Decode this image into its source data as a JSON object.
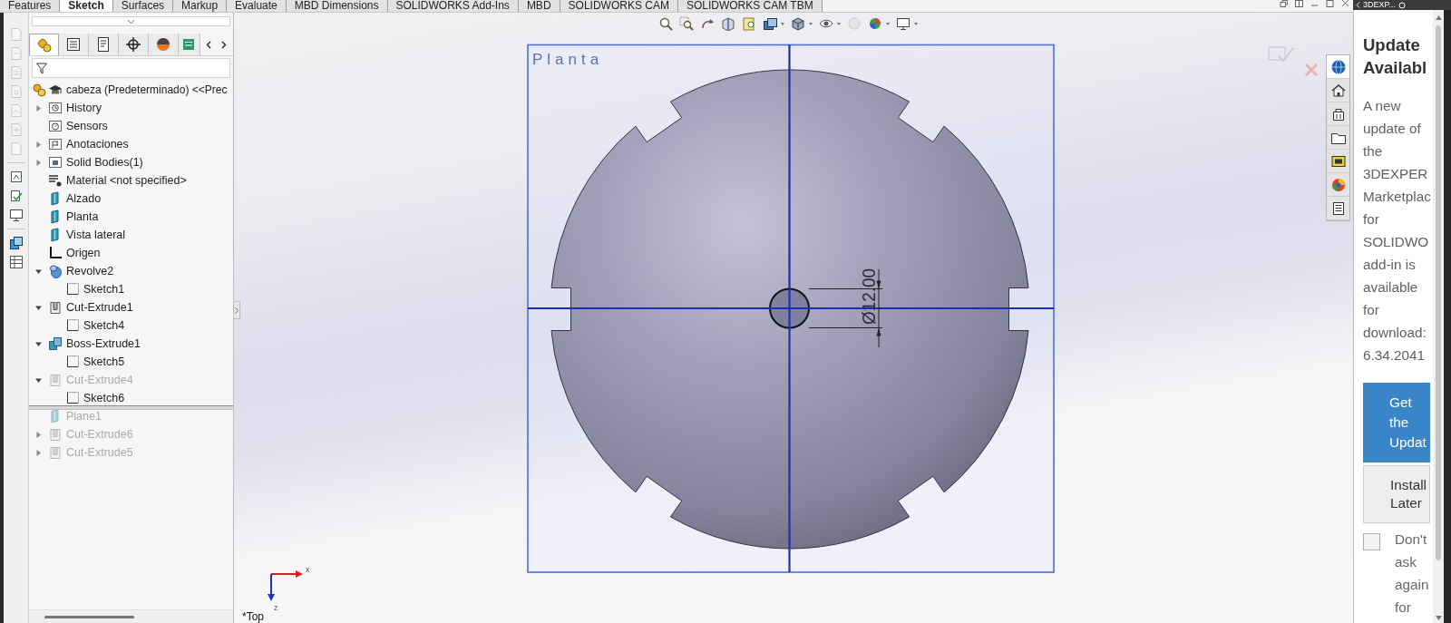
{
  "command_tabs": [
    {
      "label": "Features",
      "selected": false
    },
    {
      "label": "Sketch",
      "selected": true
    },
    {
      "label": "Surfaces",
      "selected": false
    },
    {
      "label": "Markup",
      "selected": false
    },
    {
      "label": "Evaluate",
      "selected": false
    },
    {
      "label": "MBD Dimensions",
      "selected": false
    },
    {
      "label": "SOLIDWORKS Add-Ins",
      "selected": false
    },
    {
      "label": "MBD",
      "selected": false
    },
    {
      "label": "SOLIDWORKS CAM",
      "selected": false
    },
    {
      "label": "SOLIDWORKS CAM TBM",
      "selected": false
    }
  ],
  "feature_manager": {
    "tabs": [
      {
        "kind": "features",
        "selected": true
      },
      {
        "kind": "properties",
        "selected": false
      },
      {
        "kind": "configurations",
        "selected": false
      },
      {
        "kind": "dimxpert",
        "selected": false
      },
      {
        "kind": "display",
        "selected": false
      },
      {
        "kind": "extra",
        "selected": false
      }
    ],
    "tree": {
      "label": "cabeza (Predeterminado) <<Prec",
      "kind": "part",
      "children": [
        {
          "label": "History",
          "kind": "history",
          "expanded": false,
          "suppressed": false
        },
        {
          "label": "Sensors",
          "kind": "sensors",
          "suppressed": false
        },
        {
          "label": "Anotaciones",
          "kind": "annotations",
          "expanded": false,
          "suppressed": false
        },
        {
          "label": "Solid Bodies(1)",
          "kind": "bodies",
          "expanded": false,
          "suppressed": false
        },
        {
          "label": "Material <not specified>",
          "kind": "material",
          "suppressed": false
        },
        {
          "label": "Alzado",
          "kind": "plane",
          "suppressed": false
        },
        {
          "label": "Planta",
          "kind": "plane",
          "suppressed": false
        },
        {
          "label": "Vista lateral",
          "kind": "plane",
          "suppressed": false
        },
        {
          "label": "Origen",
          "kind": "origin",
          "suppressed": false
        },
        {
          "label": "Revolve2",
          "kind": "revolve",
          "expanded": true,
          "suppressed": false,
          "children": [
            {
              "label": "Sketch1",
              "kind": "sketch",
              "suppressed": false
            }
          ]
        },
        {
          "label": "Cut-Extrude1",
          "kind": "cut",
          "expanded": true,
          "suppressed": false,
          "children": [
            {
              "label": "Sketch4",
              "kind": "sketch",
              "suppressed": false
            }
          ]
        },
        {
          "label": "Boss-Extrude1",
          "kind": "boss",
          "expanded": true,
          "suppressed": false,
          "children": [
            {
              "label": "Sketch5",
              "kind": "sketch",
              "suppressed": false
            }
          ]
        },
        {
          "label": "Cut-Extrude4",
          "kind": "cut",
          "expanded": true,
          "suppressed": true,
          "children": [
            {
              "label": "Sketch6",
              "kind": "sketch",
              "suppressed": false
            }
          ]
        },
        {
          "kind": "rollback"
        },
        {
          "label": "Plane1",
          "kind": "plane",
          "suppressed": true
        },
        {
          "label": "Cut-Extrude6",
          "kind": "cut",
          "expanded": false,
          "suppressed": true
        },
        {
          "label": "Cut-Extrude5",
          "kind": "cut",
          "expanded": false,
          "suppressed": true
        }
      ]
    }
  },
  "graphics": {
    "plane_label": "Planta",
    "dimension": "Ø12.00",
    "triad": {
      "x": "x",
      "z": "z"
    },
    "view_name": "*Top",
    "task_pane_tabs": [
      {
        "kind": "globe",
        "selected": true
      },
      {
        "kind": "home",
        "selected": false
      },
      {
        "kind": "library",
        "selected": false
      },
      {
        "kind": "folder",
        "selected": false
      },
      {
        "kind": "palette",
        "selected": false
      },
      {
        "kind": "appearance",
        "selected": false
      },
      {
        "kind": "properties",
        "selected": false
      }
    ]
  },
  "task_pane": {
    "header": "3DEXP...",
    "title": "Update Availabl",
    "message": "A new update of the 3DEXPER Marketplac for SOLIDWO add-in is available for download: 6.34.2041",
    "buttons": [
      {
        "label": "Get the Updat",
        "kind": "primary"
      },
      {
        "label": "Install Later",
        "kind": "secondary"
      }
    ],
    "dont_ask": {
      "label": "Don't ask again for",
      "checked": false
    }
  }
}
